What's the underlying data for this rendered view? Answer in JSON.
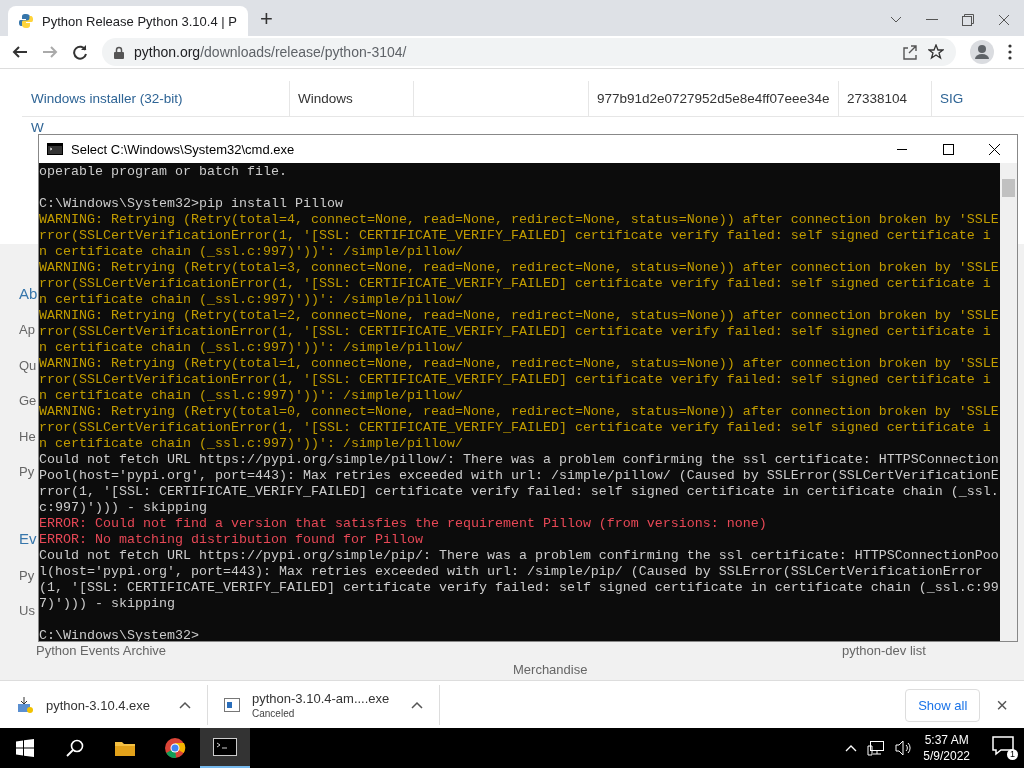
{
  "browser": {
    "tab_title": "Python Release Python 3.10.4 | P",
    "new_tab": "+",
    "url_host": "python.org",
    "url_path": "/downloads/release/python-3104/"
  },
  "page": {
    "table_rows": [
      {
        "name": "Windows installer (32-bit)",
        "os": "Windows",
        "hash": "977b91d2e0727952d5e8e4ff07eee34e",
        "size": "27338104",
        "sig": "SIG"
      }
    ],
    "cut_row_start": "W",
    "left_items": [
      {
        "text": "Ab",
        "kind": "heading"
      },
      {
        "text": "Ap",
        "kind": "link"
      },
      {
        "text": "Qu",
        "kind": "link"
      },
      {
        "text": "Ge",
        "kind": "link"
      },
      {
        "text": "He",
        "kind": "link"
      },
      {
        "text": "Py",
        "kind": "link"
      },
      {
        "text": "Ev",
        "kind": "heading"
      },
      {
        "text": "Py",
        "kind": "link"
      },
      {
        "text": "Us",
        "kind": "link"
      }
    ],
    "footer_left": "Python Events Archive",
    "footer_mid": "Merchandise",
    "footer_right": "python-dev list"
  },
  "console": {
    "title": "Select C:\\Windows\\System32\\cmd.exe",
    "lines": [
      {
        "kind": "normal",
        "text": "operable program or batch file."
      },
      {
        "kind": "blank"
      },
      {
        "kind": "normal",
        "text": "C:\\Windows\\System32>pip install Pillow"
      },
      {
        "kind": "warning",
        "text": "WARNING: Retrying (Retry(total=4, connect=None, read=None, redirect=None, status=None)) after connection broken by 'SSLError(SSLCertVerificationError(1, '[SSL: CERTIFICATE_VERIFY_FAILED] certificate verify failed: self signed certificate in certificate chain (_ssl.c:997)'))': /simple/pillow/"
      },
      {
        "kind": "warning",
        "text": "WARNING: Retrying (Retry(total=3, connect=None, read=None, redirect=None, status=None)) after connection broken by 'SSLError(SSLCertVerificationError(1, '[SSL: CERTIFICATE_VERIFY_FAILED] certificate verify failed: self signed certificate in certificate chain (_ssl.c:997)'))': /simple/pillow/"
      },
      {
        "kind": "warning",
        "text": "WARNING: Retrying (Retry(total=2, connect=None, read=None, redirect=None, status=None)) after connection broken by 'SSLError(SSLCertVerificationError(1, '[SSL: CERTIFICATE_VERIFY_FAILED] certificate verify failed: self signed certificate in certificate chain (_ssl.c:997)'))': /simple/pillow/"
      },
      {
        "kind": "warning",
        "text": "WARNING: Retrying (Retry(total=1, connect=None, read=None, redirect=None, status=None)) after connection broken by 'SSLError(SSLCertVerificationError(1, '[SSL: CERTIFICATE_VERIFY_FAILED] certificate verify failed: self signed certificate in certificate chain (_ssl.c:997)'))': /simple/pillow/"
      },
      {
        "kind": "warning",
        "text": "WARNING: Retrying (Retry(total=0, connect=None, read=None, redirect=None, status=None)) after connection broken by 'SSLError(SSLCertVerificationError(1, '[SSL: CERTIFICATE_VERIFY_FAILED] certificate verify failed: self signed certificate in certificate chain (_ssl.c:997)'))': /simple/pillow/"
      },
      {
        "kind": "normal",
        "text": "Could not fetch URL https://pypi.org/simple/pillow/: There was a problem confirming the ssl certificate: HTTPSConnectionPool(host='pypi.org', port=443): Max retries exceeded with url: /simple/pillow/ (Caused by SSLError(SSLCertVerificationError(1, '[SSL: CERTIFICATE_VERIFY_FAILED] certificate verify failed: self signed certificate in certificate chain (_ssl.c:997)'))) - skipping"
      },
      {
        "kind": "error",
        "text": "ERROR: Could not find a version that satisfies the requirement Pillow (from versions: none)"
      },
      {
        "kind": "error",
        "text": "ERROR: No matching distribution found for Pillow"
      },
      {
        "kind": "normal",
        "text": "Could not fetch URL https://pypi.org/simple/pip/: There was a problem confirming the ssl certificate: HTTPSConnectionPool(host='pypi.org', port=443): Max retries exceeded with url: /simple/pip/ (Caused by SSLError(SSLCertVerificationError(1, '[SSL: CERTIFICATE_VERIFY_FAILED] certificate verify failed: self signed certificate in certificate chain (_ssl.c:997)'))) - skipping"
      },
      {
        "kind": "blank"
      },
      {
        "kind": "normal",
        "text": "C:\\Windows\\System32>"
      }
    ]
  },
  "downloads": {
    "items": [
      {
        "name": "python-3.10.4.exe"
      },
      {
        "name": "python-3.10.4-am....exe",
        "status": "Canceled"
      }
    ],
    "show_all": "Show all",
    "close": "×"
  },
  "taskbar": {
    "apps": [
      {
        "kind": "folder",
        "active": false
      },
      {
        "kind": "chrome",
        "active": false
      },
      {
        "kind": "console",
        "active": true
      }
    ],
    "time": "5:37 AM",
    "date": "5/9/2022",
    "notifications": "1"
  }
}
